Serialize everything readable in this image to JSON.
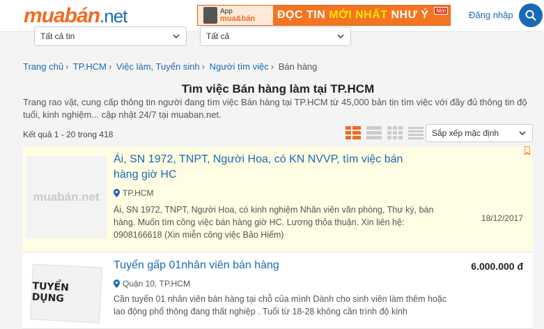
{
  "header": {
    "logo_brand": "muabán",
    "logo_tld": ".net",
    "banner_app_top": "App",
    "banner_app_brand": "mua&bán",
    "banner_text_1": "ĐỌC TIN",
    "banner_text_hl": "MỚI NHẤT",
    "banner_text_2": "NHƯ Ý",
    "banner_badge": "Mới",
    "login_label": "Đăng nhập"
  },
  "filters": {
    "category": "Tất cả tin",
    "region": "Tất cả"
  },
  "breadcrumb": [
    "Trang chủ",
    "TP.HCM",
    "Việc làm, Tuyển sinh",
    "Người tìm việc",
    "Bán hàng"
  ],
  "page": {
    "title": "Tìm việc Bán hàng làm tại TP.HCM",
    "intro": "Trang rao vặt, cung cấp thông tin người đang tìm việc Bán hàng tại TP.HCM từ 45,000 bản tin tìm việc với đầy đủ thông tin độ tuổi, kinh nghiệm... cập nhật 24/7 tại muaban.net.",
    "result_count": "Kết quả 1 - 20 trong 418",
    "sort_value": "Sắp xếp mặc định"
  },
  "listings": [
    {
      "title": "Ái, SN 1972, TNPT, Người Hoa, có KN NVVP, tìm việc bán hàng giờ HC",
      "location": "TP.HCM",
      "description": "Ái, SN 1972, TNPT, Người Hoa, có kinh nghiệm Nhân viên văn phòng, Thư ký, bán hàng. Muốn tìm công việc bán hàng giờ HC. Lương thỏa thuận. Xin liên hệ: 0908166618 (Xin miễn công việc Bảo Hiểm)",
      "date": "18/12/2017",
      "thumb_text": "muabán.net"
    },
    {
      "title": "Tuyển gấp 01nhân viên bán hàng",
      "location": "Quận 10, TP.HCM",
      "description": "Cần tuyển 01 nhân viên bán hàng tại chỗ của mình Dành cho sinh viên làm thêm hoặc lao động phổ thông đang thất nghiệp . Tuổi từ 18-28 không cần trình độ kinh",
      "price": "6.000.000 đ",
      "thumb_text": "TUYỂN DỤNG"
    }
  ],
  "colors": {
    "brand_orange": "#f26a21",
    "link_blue": "#1a69b5",
    "vip_bg": "#fffde3"
  }
}
